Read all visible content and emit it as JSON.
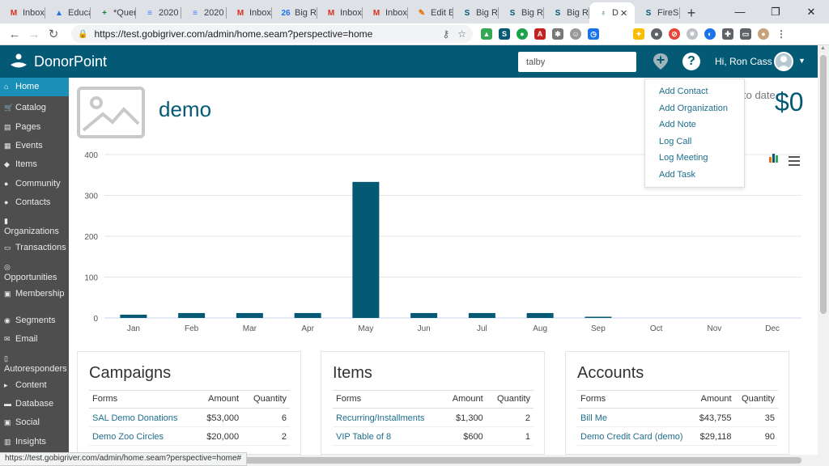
{
  "browser": {
    "tabs": [
      {
        "title": "Inbox",
        "icon": "gmail-icon",
        "fav": "M",
        "color": "#d93025"
      },
      {
        "title": "Educa",
        "icon": "drive-icon",
        "fav": "▲",
        "color": "#1a73e8"
      },
      {
        "title": "*Quer",
        "icon": "sheets-icon",
        "fav": "+",
        "color": "#188038"
      },
      {
        "title": "2020",
        "icon": "docs-icon",
        "fav": "≡",
        "color": "#4285f4"
      },
      {
        "title": "2020",
        "icon": "docs-icon",
        "fav": "≡",
        "color": "#4285f4"
      },
      {
        "title": "Inbox",
        "icon": "gmail-icon",
        "fav": "M",
        "color": "#d93025"
      },
      {
        "title": "Big Ri",
        "icon": "calendar-icon",
        "fav": "26",
        "color": "#1a73e8"
      },
      {
        "title": "Inbox",
        "icon": "gmail-icon",
        "fav": "M",
        "color": "#d93025"
      },
      {
        "title": "Inbox",
        "icon": "gmail-icon",
        "fav": "M",
        "color": "#d93025"
      },
      {
        "title": "Edit E",
        "icon": "edit-icon",
        "fav": "✎",
        "color": "#e8710a"
      },
      {
        "title": "Big Ri",
        "icon": "site-icon",
        "fav": "S",
        "color": "#045a75"
      },
      {
        "title": "Big Ri",
        "icon": "site-icon",
        "fav": "S",
        "color": "#045a75"
      },
      {
        "title": "Big Ri",
        "icon": "site-icon",
        "fav": "S",
        "color": "#045a75"
      },
      {
        "title": "D",
        "icon": "donorpoint-icon",
        "fav": "♁",
        "color": "#045a75",
        "active": true
      },
      {
        "title": "FireS",
        "icon": "firespring-icon",
        "fav": "S",
        "color": "#045a75"
      }
    ],
    "new_tab": "+",
    "tab_close": "✕",
    "window_controls": {
      "minimize": "—",
      "restore": "❐",
      "close": "✕"
    },
    "nav": {
      "back": "←",
      "forward": "→",
      "reload": "↻"
    },
    "url": "https://test.gobigriver.com/admin/home.seam?perspective=home",
    "url_host": "https://test.gobigriver.com",
    "url_path": "/admin/home.seam?perspective=home",
    "status_url": "https://test.gobigriver.com/admin/home.seam?perspective=home#"
  },
  "app": {
    "brand": "DonorPoint",
    "search_value": "talby",
    "greeting": "Hi, Ron Cass",
    "accent": "#045a75"
  },
  "sidebar": {
    "items": [
      {
        "label": "Home",
        "icon": "home-icon",
        "glyph": "⌂",
        "active": true
      },
      {
        "label": "Catalog",
        "icon": "cart-icon",
        "glyph": "🛒"
      },
      {
        "label": "Pages",
        "icon": "pages-icon",
        "glyph": "▤"
      },
      {
        "label": "Events",
        "icon": "calendar-icon",
        "glyph": "▦"
      },
      {
        "label": "Items",
        "icon": "tag-icon",
        "glyph": "◆"
      },
      {
        "label": "Community",
        "icon": "users-icon",
        "glyph": "●"
      },
      {
        "label": "Contacts",
        "icon": "user-icon",
        "glyph": "●"
      },
      {
        "label": "Organizations",
        "icon": "building-icon",
        "glyph": "▮"
      },
      {
        "label": "Transactions",
        "icon": "money-icon",
        "glyph": "▭"
      },
      {
        "label": "Opportunities",
        "icon": "target-icon",
        "glyph": "◎"
      },
      {
        "label": "Membership",
        "icon": "card-icon",
        "glyph": "▣"
      },
      {
        "label": "Segments",
        "icon": "segments-icon",
        "glyph": "◉"
      },
      {
        "label": "Email",
        "icon": "envelope-icon",
        "glyph": "✉"
      },
      {
        "label": "Autoresponders",
        "icon": "book-icon",
        "glyph": "▯"
      },
      {
        "label": "Content",
        "icon": "content-icon",
        "glyph": "▸"
      },
      {
        "label": "Database",
        "icon": "database-icon",
        "glyph": "▬"
      },
      {
        "label": "Social",
        "icon": "social-icon",
        "glyph": "▣"
      },
      {
        "label": "Insights",
        "icon": "insights-icon",
        "glyph": "▥"
      }
    ]
  },
  "main": {
    "title": "demo",
    "to_date_label": "to date",
    "total": "$0"
  },
  "add_menu": {
    "items": [
      "Add Contact",
      "Add Organization",
      "Add Note",
      "Log Call",
      "Log Meeting",
      "Add Task"
    ]
  },
  "chart_data": {
    "type": "bar",
    "categories": [
      "Jan",
      "Feb",
      "Mar",
      "Apr",
      "May",
      "Jun",
      "Jul",
      "Aug",
      "Sep",
      "Oct",
      "Nov",
      "Dec"
    ],
    "values": [
      8,
      12,
      12,
      12,
      333,
      12,
      12,
      12,
      3,
      0,
      0,
      0
    ],
    "yticks": [
      0,
      100,
      200,
      300,
      400
    ],
    "ylim": [
      0,
      400
    ],
    "grid": true,
    "bar_color": "#045a75"
  },
  "panels": [
    {
      "title": "Campaigns",
      "headers": [
        "Forms",
        "Amount",
        "Quantity"
      ],
      "rows": [
        {
          "name": "SAL Demo Donations",
          "amount": "$53,000",
          "qty": "6"
        },
        {
          "name": "Demo Zoo Circles",
          "amount": "$20,000",
          "qty": "2"
        }
      ]
    },
    {
      "title": "Items",
      "headers": [
        "Forms",
        "Amount",
        "Quantity"
      ],
      "rows": [
        {
          "name": "Recurring/Installments",
          "amount": "$1,300",
          "qty": "2"
        },
        {
          "name": "VIP Table of 8",
          "amount": "$600",
          "qty": "1"
        }
      ]
    },
    {
      "title": "Accounts",
      "headers": [
        "Forms",
        "Amount",
        "Quantity"
      ],
      "rows": [
        {
          "name": "Bill Me",
          "amount": "$43,755",
          "qty": "35"
        },
        {
          "name": "Demo Credit Card (demo)",
          "amount": "$29,118",
          "qty": "90"
        }
      ]
    }
  ]
}
